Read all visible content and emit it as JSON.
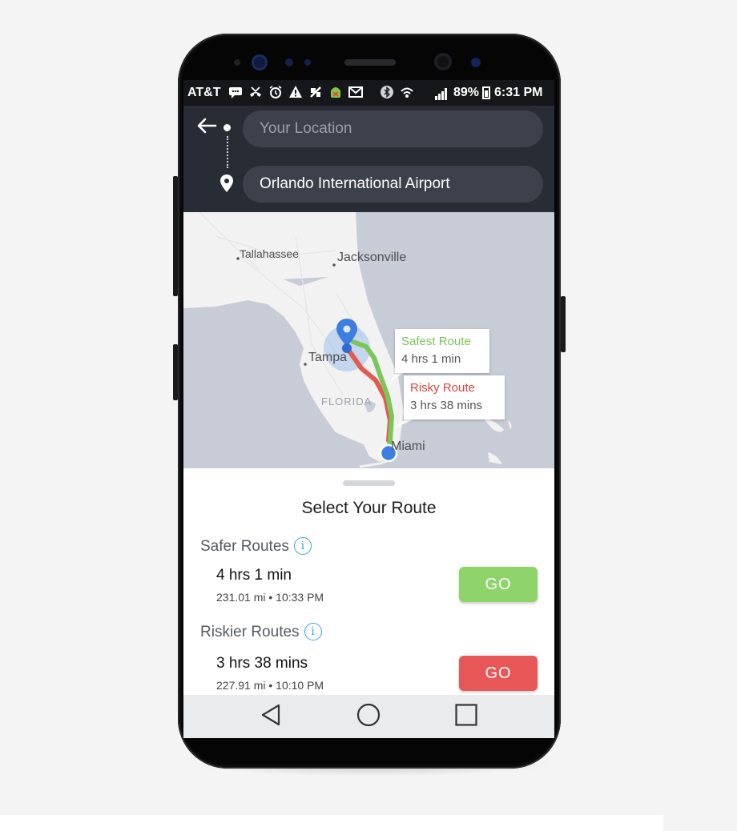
{
  "status_bar": {
    "carrier": "AT&T",
    "icons": [
      "message-icon",
      "missed-call-icon",
      "alarm-icon",
      "warning-icon",
      "no-signal-icon",
      "android-icon",
      "mail-icon",
      "bluetooth-icon",
      "lte-icon",
      "signal-icon"
    ],
    "battery": "89%",
    "time": "6:31 PM"
  },
  "header": {
    "origin_placeholder": "Your Location",
    "destination": "Orlando International Airport"
  },
  "map": {
    "cities": [
      "Tallahassee",
      "Jacksonville",
      "Tampa",
      "Miami"
    ],
    "state": "FLORIDA",
    "callouts": {
      "safest": {
        "title": "Safest Route",
        "time": "4 hrs 1 min",
        "color": "#7bc65a"
      },
      "risky": {
        "title": "Risky Route",
        "time": "3 hrs 38 mins",
        "color": "#d9443c"
      }
    }
  },
  "sheet": {
    "title": "Select Your Route",
    "sections": [
      {
        "label": "Safer Routes",
        "time": "4 hrs 1 min",
        "meta": "231.01 mi • 10:33 PM",
        "button": "GO",
        "color": "#8ed46a"
      },
      {
        "label": "Riskier Routes",
        "time": "3 hrs 38 mins",
        "meta": "227.91 mi • 10:10 PM",
        "button": "GO",
        "color": "#e85757"
      }
    ]
  },
  "nav": [
    "back-icon",
    "home-icon",
    "recents-icon"
  ]
}
